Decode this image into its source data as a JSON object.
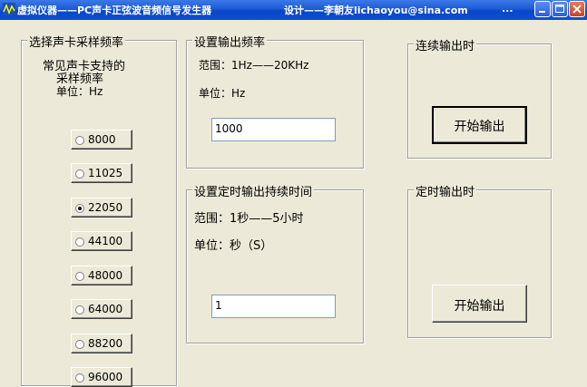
{
  "window": {
    "title": "虚拟仪器——PC声卡正弦波音频信号发生器",
    "designer": "设计——李朝友lichaoyou@sina.com",
    "ellipsis": "...",
    "icon": "app-icon",
    "controls": [
      "minimize-icon",
      "maximize-icon",
      "close-icon"
    ]
  },
  "sample_rate_group": {
    "title": "选择声卡采样频率",
    "note_line1": "常见声卡支持的",
    "note_line2": "采样频率",
    "unit": "单位：Hz",
    "options": [
      "8000",
      "11025",
      "22050",
      "44100",
      "48000",
      "64000",
      "88200",
      "96000"
    ],
    "selected": "22050"
  },
  "output_freq_group": {
    "title": "设置输出频率",
    "range": "范围：1Hz——20KHz",
    "unit": "单位：Hz",
    "value": "1000"
  },
  "duration_group": {
    "title": "设置定时输出持续时间",
    "range": "范围：1秒——5小时",
    "unit": "单位：秒（S）",
    "value": "1"
  },
  "continuous_group": {
    "title": "连续输出时",
    "button": "开始输出"
  },
  "timed_group": {
    "title": "定时输出时",
    "button": "开始输出"
  }
}
